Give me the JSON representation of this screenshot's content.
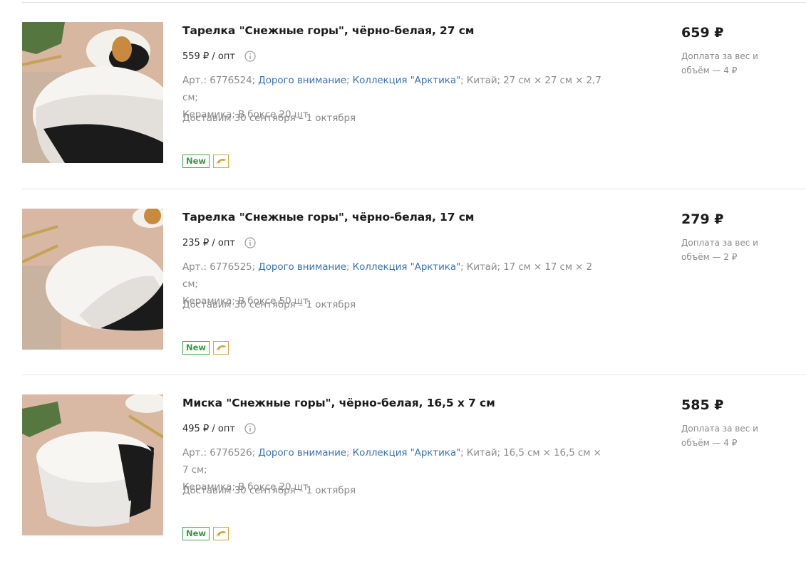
{
  "products": [
    {
      "title": "Тарелка \"Снежные горы\", чёрно-белая, 27 см",
      "wholesale": "559 ₽ / опт",
      "article_prefix": "Арт.: 6776524;",
      "tag1": "Дорого внимание",
      "tag2": "Коллекция \"Арктика\"",
      "specs": "; Китай; 27 см × 27 см × 2,7 см;",
      "material": "Керамика; В боксе 20 шт.",
      "delivery": "Доставим 30 сентября – 1 октября",
      "badge_new": "New",
      "price": "659 ₽",
      "surcharge": "Доплата за вес и объём — 4 ₽"
    },
    {
      "title": "Тарелка \"Снежные горы\", чёрно-белая, 17 см",
      "wholesale": "235 ₽ / опт",
      "article_prefix": "Арт.: 6776525;",
      "tag1": "Дорого внимание",
      "tag2": "Коллекция \"Арктика\"",
      "specs": "; Китай; 17 см × 17 см × 2 см;",
      "material": "Керамика; В боксе 50 шт.",
      "delivery": "Доставим 30 сентября – 1 октября",
      "badge_new": "New",
      "price": "279 ₽",
      "surcharge": "Доплата за вес и объём — 2 ₽"
    },
    {
      "title": "Миска \"Снежные горы\", чёрно-белая, 16,5 х 7 см",
      "wholesale": "495 ₽ / опт",
      "article_prefix": "Арт.: 6776526;",
      "tag1": "Дорого внимание",
      "tag2": "Коллекция \"Арктика\"",
      "specs": "; Китай; 16,5 см × 16,5 см × 7 см;",
      "material": "Керамика; В боксе 20 шт.",
      "delivery": "Доставим 30 сентября – 1 октября",
      "badge_new": "New",
      "price": "585 ₽",
      "surcharge": "Доплата за вес и объём — 4 ₽"
    }
  ],
  "icons": {
    "info": "info-icon",
    "dolphin": "dolphin-icon"
  },
  "colors": {
    "link": "#3a73b8",
    "new_badge": "#3aaa4a",
    "dolphin_badge": "#d2a43c",
    "muted_text": "#8a8a8a"
  }
}
